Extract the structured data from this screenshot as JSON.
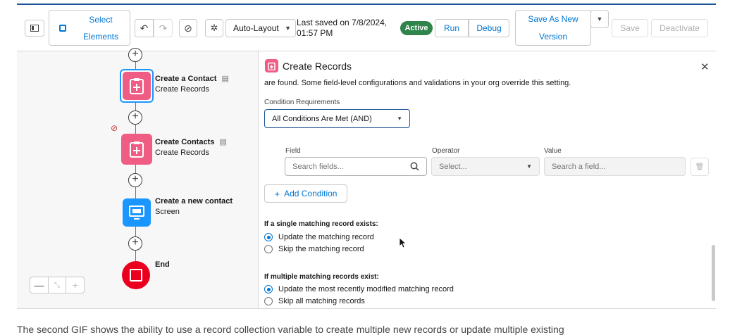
{
  "toolbar": {
    "select_elements": "Select Elements",
    "layout_mode": "Auto-Layout",
    "last_saved": "Last saved on 7/8/2024, 01:57 PM",
    "status": "Active",
    "run": "Run",
    "debug": "Debug",
    "save_as_new_version": "Save As New Version",
    "save": "Save",
    "deactivate": "Deactivate"
  },
  "canvas": {
    "nodes": [
      {
        "title": "Create a Contact",
        "subtitle": "Create Records",
        "color": "#ef5c84",
        "icon": "create-records-icon"
      },
      {
        "title": "Create Contacts",
        "subtitle": "Create Records",
        "color": "#ef5c84",
        "icon": "create-records-icon"
      },
      {
        "title": "Create a new contact",
        "subtitle": "Screen",
        "color": "#1b96ff",
        "icon": "screen-icon"
      },
      {
        "title": "End",
        "subtitle": "",
        "color": "#ea001e",
        "icon": "stop-icon"
      }
    ],
    "zoom_out": "—",
    "zoom_in": "+"
  },
  "panel": {
    "title": "Create Records",
    "intro_text": "are found. Some field-level configurations and validations in your org override this setting.",
    "condition_requirements_label": "Condition Requirements",
    "condition_requirements_value": "All Conditions Are Met (AND)",
    "columns": {
      "field": "Field",
      "operator": "Operator",
      "value": "Value"
    },
    "field_placeholder": "Search fields...",
    "operator_placeholder": "Select...",
    "value_placeholder": "Search a field...",
    "add_condition": "Add Condition",
    "single_heading": "If a single matching record exists:",
    "single_options": [
      "Update the matching record",
      "Skip the matching record"
    ],
    "single_selected": 0,
    "multiple_heading": "If multiple matching records exist:",
    "multiple_options": [
      "Update the most recently modified matching record",
      "Skip all matching records"
    ],
    "multiple_selected": 0
  },
  "caption": "The second GIF shows the ability to use a record collection variable to create multiple new records or update multiple existing"
}
